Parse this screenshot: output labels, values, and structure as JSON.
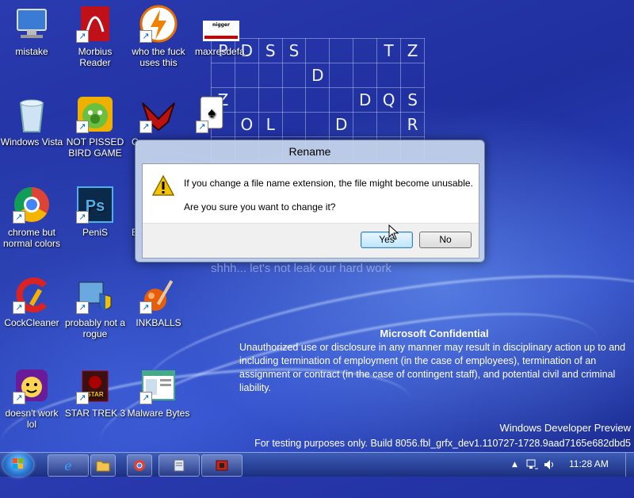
{
  "desktop": {
    "icons": [
      {
        "label": "mistake"
      },
      {
        "label": "Morbius Reader"
      },
      {
        "label": "who the fuck uses this"
      },
      {
        "label": "maxresdefa..."
      },
      {
        "label": "Windows Vista"
      },
      {
        "label": "NOT PISSED BIRD GAME"
      },
      {
        "label": "C"
      },
      {
        "label": "chrome but normal colors"
      },
      {
        "label": "PeniS"
      },
      {
        "label": "E"
      },
      {
        "label": "CockCleaner"
      },
      {
        "label": "probably not a rogue"
      },
      {
        "label": "INKBALLS"
      },
      {
        "label": "doesn't work lol"
      },
      {
        "label": "STAR TREK 3"
      },
      {
        "label": "Malware Bytes"
      }
    ],
    "thumbnail_text": "nigger",
    "puzzle_rows": [
      [
        "P",
        "D",
        "S",
        "S",
        "",
        "",
        "",
        "T",
        "Z"
      ],
      [
        "",
        "",
        "",
        "",
        "D",
        "",
        "",
        "",
        ""
      ],
      [
        "Z",
        "",
        "",
        "",
        "",
        "",
        "D",
        "Q",
        "S"
      ],
      [
        "",
        "O",
        "L",
        "",
        "",
        "D",
        "",
        "",
        "R"
      ],
      [
        "",
        "",
        "",
        "",
        "",
        "",
        "",
        "",
        ""
      ]
    ],
    "watermark": "shhh... let's not leak our hard work"
  },
  "dialog": {
    "title": "Rename",
    "message_line1": "If you change a file name extension, the file might become unusable.",
    "message_line2": "Are you sure you want to change it?",
    "yes_label": "Yes",
    "no_label": "No"
  },
  "confidential": {
    "heading": "Microsoft Confidential",
    "body": "Unauthorized use or disclosure in any manner may result in disciplinary action up to and including termination of employment (in the case of employees), termination of an assignment or contract (in the case of contingent staff), and potential civil and criminal liability."
  },
  "build": {
    "line1": "Windows Developer Preview",
    "line2": "For testing purposes only. Build 8056.fbl_grfx_dev1.110727-1728.9aad7165e682dbd5"
  },
  "taskbar": {
    "time": "11:28 AM",
    "tray_arrow": "▲"
  },
  "colors": {
    "desktop_blue": "#2a3bb0",
    "dialog_frame": "#c8d7eb",
    "warning_yellow": "#f5c400"
  }
}
